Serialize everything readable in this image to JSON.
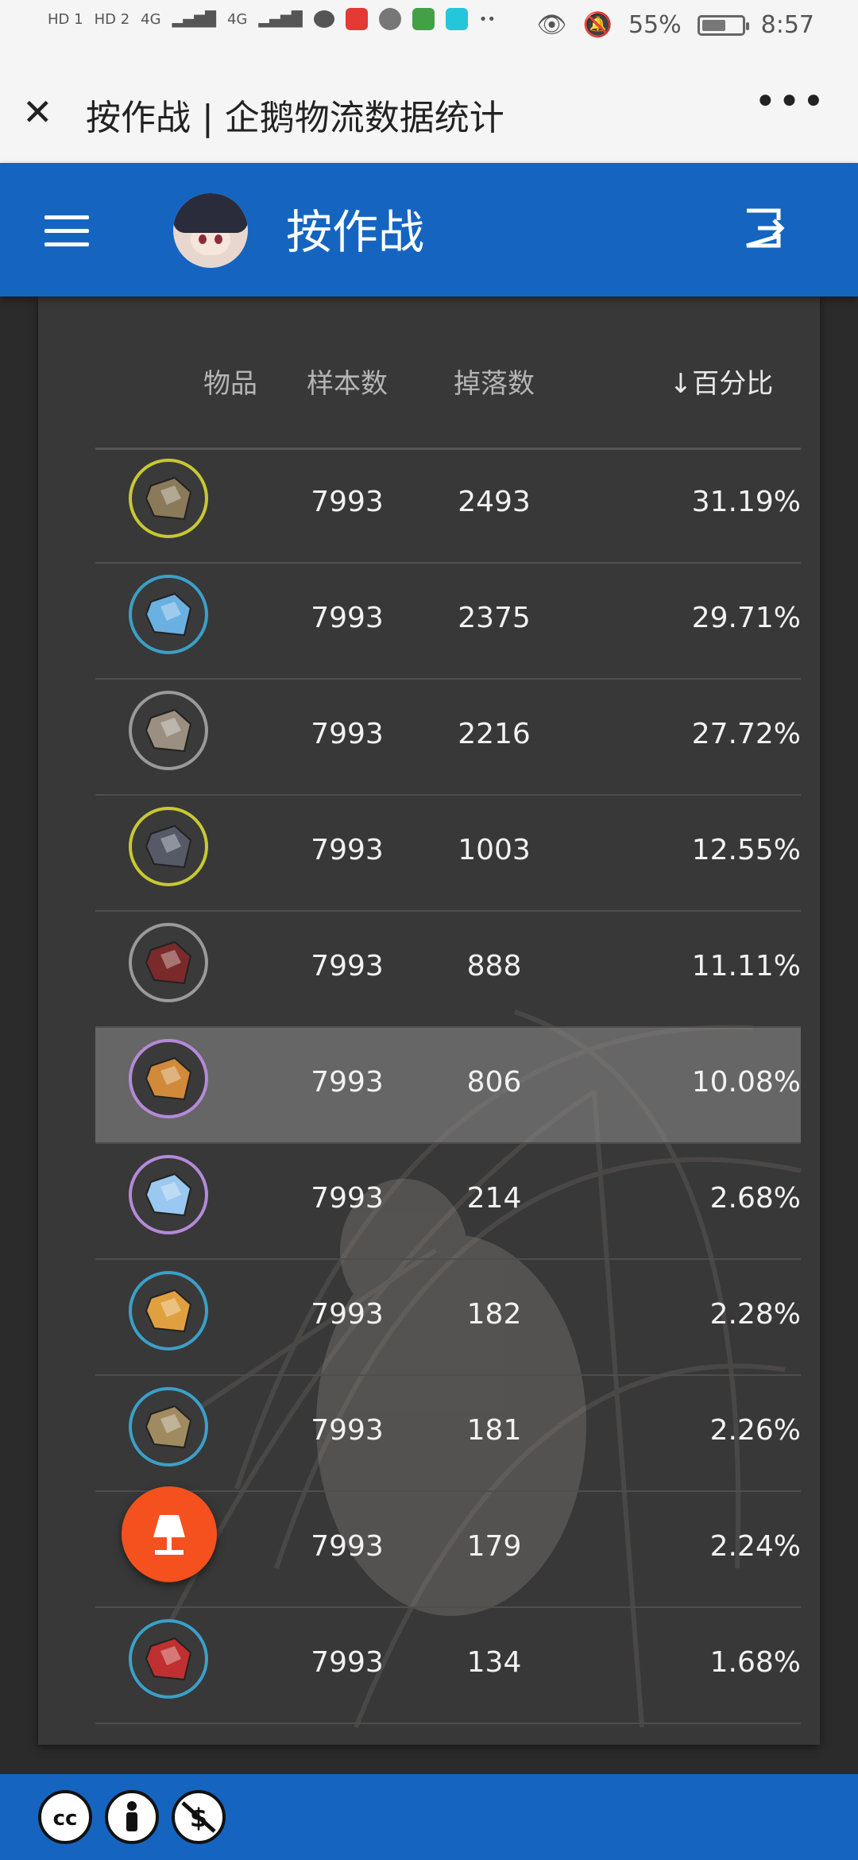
{
  "status_bar": {
    "left_labels": [
      "HD 1",
      "HD 2",
      "4G",
      "4G"
    ],
    "battery": "55%",
    "time": "8:57"
  },
  "wechat_bar": {
    "title": "按作战 | 企鹅物流数据统计",
    "more": "•••"
  },
  "app_bar": {
    "title": "按作战"
  },
  "table": {
    "headers": {
      "item": "物品",
      "samples": "样本数",
      "drops": "掉落数",
      "percent": "百分比",
      "sort_arrow": "↓"
    },
    "rows": [
      {
        "icon": "cube-ore-icon",
        "ring": "#c8c832",
        "samples": "7993",
        "drops": "2493",
        "percent": "31.19%"
      },
      {
        "icon": "blue-crystal-icon",
        "ring": "#3aa0c8",
        "samples": "7993",
        "drops": "2375",
        "percent": "29.71%"
      },
      {
        "icon": "rock-icon",
        "ring": "#9a9a9a",
        "samples": "7993",
        "drops": "2216",
        "percent": "27.72%"
      },
      {
        "icon": "device-box-icon",
        "ring": "#c8c832",
        "samples": "7993",
        "drops": "1003",
        "percent": "12.55%"
      },
      {
        "icon": "red-device-icon",
        "ring": "#9a9a9a",
        "samples": "7993",
        "drops": "888",
        "percent": "11.11%"
      },
      {
        "icon": "gold-ingot-icon",
        "ring": "#b48ad8",
        "samples": "7993",
        "drops": "806",
        "percent": "10.08%"
      },
      {
        "icon": "ice-crystal-icon",
        "ring": "#b48ad8",
        "samples": "7993",
        "drops": "214",
        "percent": "2.68%"
      },
      {
        "icon": "recipe-paper-icon",
        "ring": "#3aa0c8",
        "samples": "7993",
        "drops": "182",
        "percent": "2.28%"
      },
      {
        "icon": "ore-pile-icon",
        "ring": "#3aa0c8",
        "samples": "7993",
        "drops": "181",
        "percent": "2.26%"
      },
      {
        "icon": "lamp-icon",
        "ring": "#f4511e",
        "samples": "7993",
        "drops": "179",
        "percent": "2.24%"
      },
      {
        "icon": "red-cube-icon",
        "ring": "#3aa0c8",
        "samples": "7993",
        "drops": "134",
        "percent": "1.68%"
      }
    ],
    "highlighted_row": 5
  },
  "footer": {
    "license_icons": [
      "cc-icon",
      "by-icon",
      "nc-icon"
    ]
  },
  "colors": {
    "primary": "#1565c0",
    "fab": "#f4511e",
    "card": "#383838"
  }
}
